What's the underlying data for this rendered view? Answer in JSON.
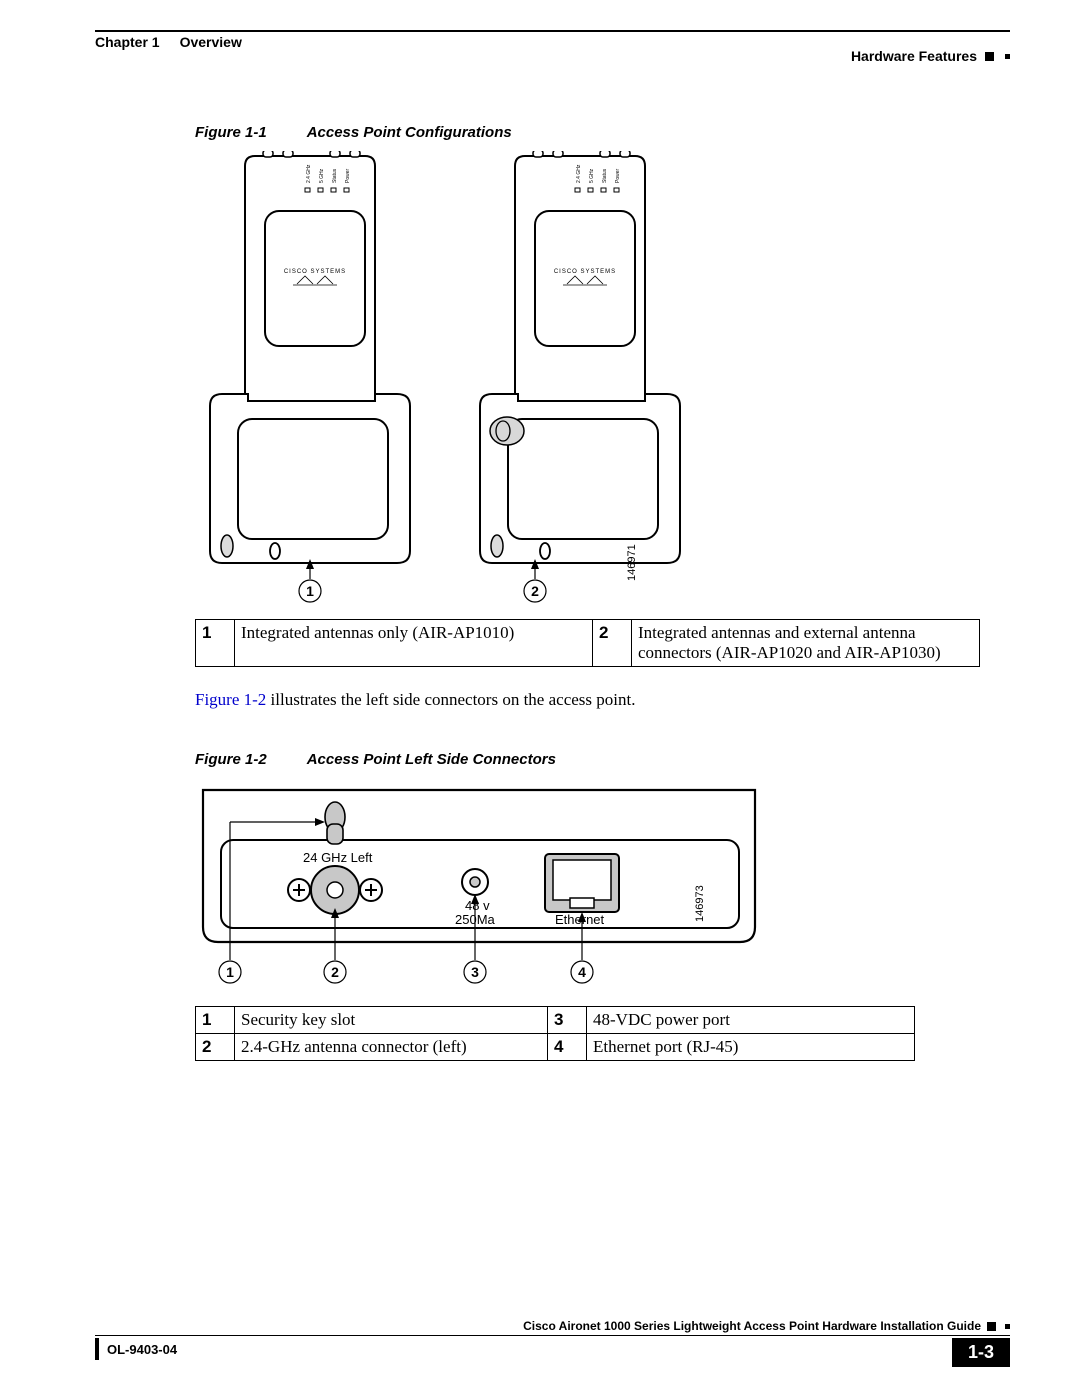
{
  "header": {
    "chapter": "Chapter 1",
    "title": "Overview",
    "section": "Hardware Features"
  },
  "figure1": {
    "label": "Figure 1-1",
    "title": "Access Point Configurations",
    "drawing_id": "146971",
    "device_label": "CISCO SYSTEMS",
    "led_labels": [
      "2.4 GHz",
      "5 GHz",
      "Status",
      "Power"
    ],
    "callouts": {
      "1": "1",
      "2": "2"
    },
    "legend": [
      {
        "num": "1",
        "text": "Integrated antennas only (AIR-AP1010)"
      },
      {
        "num": "2",
        "text": "Integrated antennas and external antenna connectors (AIR-AP1020 and AIR-AP1030)"
      }
    ]
  },
  "body": {
    "ref": "Figure 1-2",
    "rest": " illustrates the left side connectors on the access point."
  },
  "figure2": {
    "label": "Figure 1-2",
    "title": "Access Point Left Side Connectors",
    "drawing_id": "146973",
    "labels": {
      "antenna": "24 GHz Left",
      "power1": "48 v",
      "power2": "250Ma",
      "ethernet": "Ethernet"
    },
    "callouts": {
      "1": "1",
      "2": "2",
      "3": "3",
      "4": "4"
    },
    "legend": [
      {
        "num": "1",
        "text": "Security key slot"
      },
      {
        "num": "2",
        "text": "2.4-GHz antenna connector (left)"
      },
      {
        "num": "3",
        "text": "48-VDC power port"
      },
      {
        "num": "4",
        "text": "Ethernet port (RJ-45)"
      }
    ]
  },
  "footer": {
    "guide": "Cisco Aironet 1000 Series Lightweight Access Point Hardware Installation Guide",
    "docnum": "OL-9403-04",
    "pagenum": "1-3"
  }
}
